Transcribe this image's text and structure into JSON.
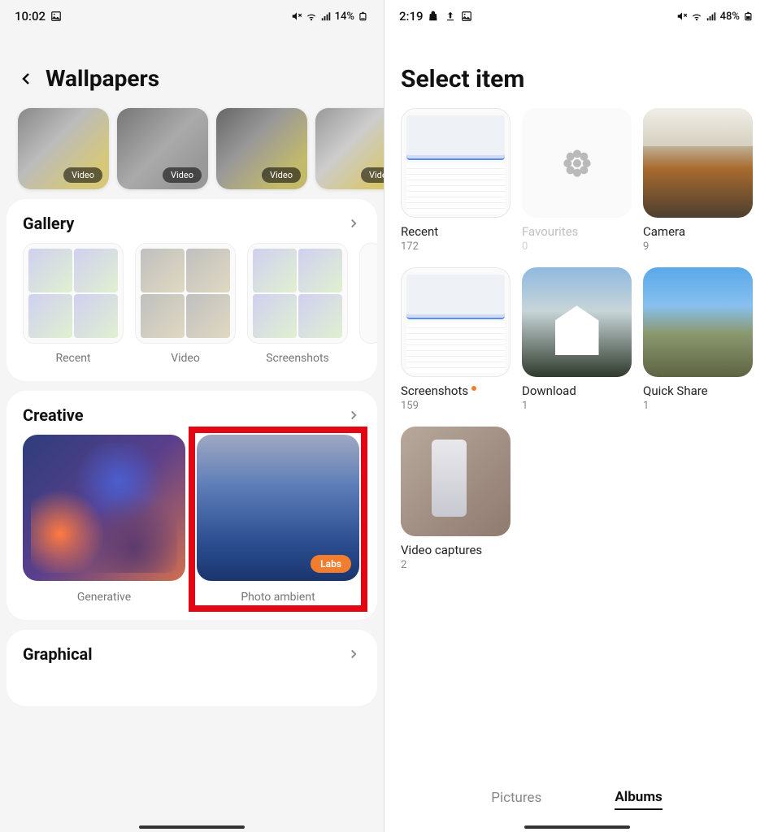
{
  "left": {
    "status": {
      "time": "10:02",
      "battery": "14%"
    },
    "header": {
      "title": "Wallpapers"
    },
    "video_badge": "Video",
    "sections": {
      "gallery": {
        "title": "Gallery",
        "items": [
          {
            "label": "Recent"
          },
          {
            "label": "Video"
          },
          {
            "label": "Screenshots"
          }
        ]
      },
      "creative": {
        "title": "Creative",
        "items": [
          {
            "label": "Generative"
          },
          {
            "label": "Photo ambient",
            "badge": "Labs"
          }
        ]
      },
      "graphical": {
        "title": "Graphical"
      }
    }
  },
  "right": {
    "status": {
      "time": "2:19",
      "battery": "48%"
    },
    "header": {
      "title": "Select item"
    },
    "albums": [
      {
        "name": "Recent",
        "count": "172"
      },
      {
        "name": "Favourites",
        "count": "0"
      },
      {
        "name": "Camera",
        "count": "9"
      },
      {
        "name": "Screenshots",
        "count": "159",
        "dot": true
      },
      {
        "name": "Download",
        "count": "1"
      },
      {
        "name": "Quick Share",
        "count": "1"
      },
      {
        "name": "Video captures",
        "count": "2"
      }
    ],
    "tabs": {
      "pictures": "Pictures",
      "albums": "Albums"
    }
  }
}
